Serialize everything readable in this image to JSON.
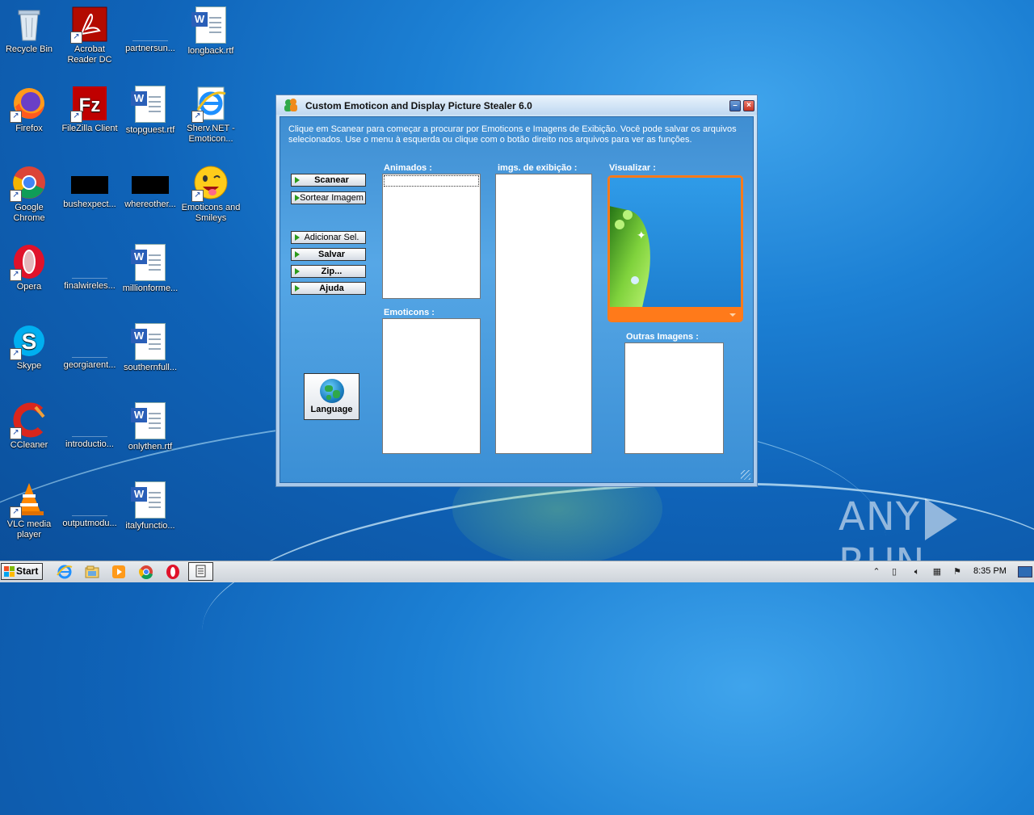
{
  "desktop": {
    "icons": [
      {
        "label": "Recycle Bin",
        "icon": "recycle-bin-icon"
      },
      {
        "label": "Acrobat\nReader DC",
        "icon": "acrobat-icon"
      },
      {
        "label": "partnersun...",
        "icon": "blank-file-icon"
      },
      {
        "label": "longback.rtf",
        "icon": "word-doc-icon"
      },
      {
        "label": "Firefox",
        "icon": "firefox-icon"
      },
      {
        "label": "FileZilla Client",
        "icon": "filezilla-icon"
      },
      {
        "label": "stopguest.rtf",
        "icon": "word-doc-icon"
      },
      {
        "label": "Sherv.NET -\nEmoticon...",
        "icon": "ie-icon"
      },
      {
        "label": "Google\nChrome",
        "icon": "chrome-icon"
      },
      {
        "label": "bushexpect...",
        "icon": "black-file-icon"
      },
      {
        "label": "whereother...",
        "icon": "black-file-icon"
      },
      {
        "label": "Emoticons and\nSmileys",
        "icon": "smiley-icon"
      },
      {
        "label": "Opera",
        "icon": "opera-icon"
      },
      {
        "label": "finalwireles...",
        "icon": "blank-file-icon"
      },
      {
        "label": "millionforme...",
        "icon": "word-doc-icon"
      },
      {
        "label": "Skype",
        "icon": "skype-icon"
      },
      {
        "label": "georgiarent...",
        "icon": "blank-file-icon"
      },
      {
        "label": "southernfull...",
        "icon": "word-doc-icon"
      },
      {
        "label": "CCleaner",
        "icon": "ccleaner-icon"
      },
      {
        "label": "introductio...",
        "icon": "blank-file-icon"
      },
      {
        "label": "onlythen.rtf",
        "icon": "word-doc-icon"
      },
      {
        "label": "VLC media\nplayer",
        "icon": "vlc-icon"
      },
      {
        "label": "outputmodu...",
        "icon": "blank-file-icon"
      },
      {
        "label": "italyfunctio...",
        "icon": "word-doc-icon"
      }
    ]
  },
  "window": {
    "title": "Custom Emoticon and Display Picture Stealer 6.0",
    "description": "Clique em Scanear para começar a procurar por Emoticons e Imagens de Exibição. Você pode salvar os arquivos selecionados. Use o menu à esquerda ou clique com o botão direito nos arquivos para ver as funções.",
    "buttons": {
      "scan": "Scanear",
      "random_image": "Sortear Imagem",
      "add_selected": "Adicionar Sel.",
      "save": "Salvar",
      "zip": "Zip...",
      "help": "Ajuda",
      "language": "Language"
    },
    "panels": {
      "animated": "Animados :",
      "display_pictures": "imgs. de exibição :",
      "preview": "Visualizar :",
      "emoticons": "Emoticons :",
      "other_images": "Outras Imagens :"
    }
  },
  "watermark": {
    "left": "ANY",
    "right": "RUN"
  },
  "taskbar": {
    "start_label": "Start",
    "clock": "8:35 PM"
  },
  "colors": {
    "accent": "#ff7a1a",
    "window_client": "#4a9be0"
  }
}
